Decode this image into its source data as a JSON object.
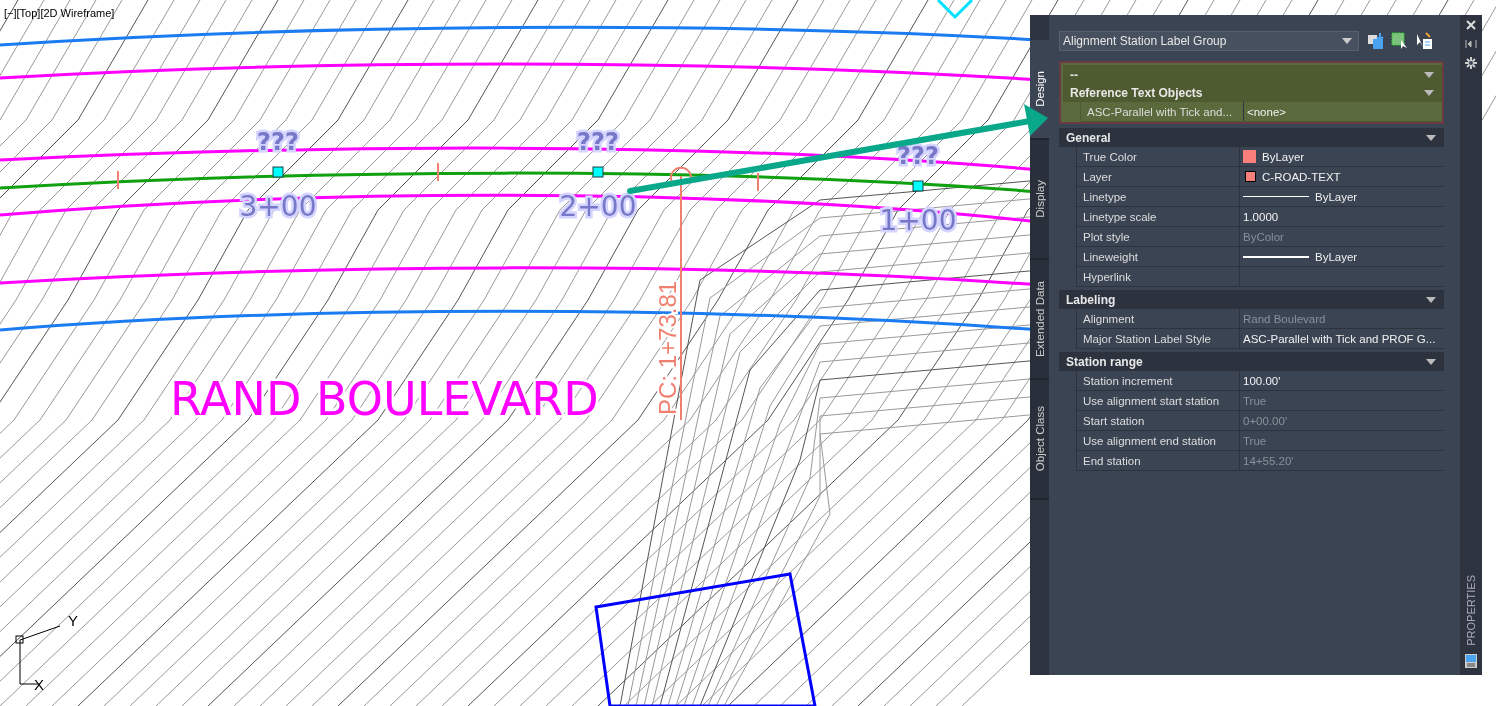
{
  "viewport": {
    "label": "[−][Top][2D Wireframe]"
  },
  "drawing": {
    "stations": [
      {
        "mark": "???",
        "station": "3+00"
      },
      {
        "mark": "???",
        "station": "2+00"
      },
      {
        "mark": "???",
        "station": "1+00"
      }
    ],
    "street_name": "RAND BOULEVARD",
    "curve_label": "PC: 1+73.81",
    "ucs": {
      "y": "Y",
      "x": "X"
    }
  },
  "properties": {
    "object_type": "Alignment Station Label Group",
    "tabs": [
      {
        "label": "Design",
        "selected": true
      },
      {
        "label": "Display",
        "selected": false
      },
      {
        "label": "Extended Data",
        "selected": false
      },
      {
        "label": "Object Class",
        "selected": false
      }
    ],
    "sections": [
      {
        "title": "--",
        "expanded": true,
        "highlighted": true
      },
      {
        "title": "Reference Text Objects",
        "expanded": true,
        "highlighted": true,
        "rows": [
          {
            "kind": "text",
            "name": "ASC-Parallel with Tick and...",
            "value": "<none>",
            "disabled": false
          }
        ]
      },
      {
        "title": "General",
        "expanded": true,
        "highlighted": false,
        "rows": [
          {
            "kind": "swatch",
            "name": "True Color",
            "value": "ByLayer",
            "color": "#f87f7a",
            "disabled": false
          },
          {
            "kind": "layer",
            "name": "Layer",
            "value": "C-ROAD-TEXT",
            "color": "#f87f7a",
            "disabled": false
          },
          {
            "kind": "line",
            "name": "Linetype",
            "value": "ByLayer",
            "disabled": false
          },
          {
            "kind": "text",
            "name": "Linetype scale",
            "value": "1.0000",
            "disabled": false
          },
          {
            "kind": "text",
            "name": "Plot style",
            "value": "ByColor",
            "disabled": true
          },
          {
            "kind": "line",
            "name": "Lineweight",
            "value": "ByLayer",
            "disabled": false
          },
          {
            "kind": "empty",
            "name": "Hyperlink"
          }
        ]
      },
      {
        "title": "Labeling",
        "expanded": true,
        "highlighted": false,
        "rows": [
          {
            "kind": "text",
            "name": "Alignment",
            "value": "Rand Boulevard",
            "disabled": true
          },
          {
            "kind": "text",
            "name": "Major Station Label Style",
            "value": "ASC-Parallel with Tick and PROF G...",
            "disabled": false
          }
        ]
      },
      {
        "title": "Station range",
        "expanded": true,
        "highlighted": false,
        "rows": [
          {
            "kind": "text",
            "name": "Station increment",
            "value": "100.00'",
            "disabled": false
          },
          {
            "kind": "text",
            "name": "Use alignment start station",
            "value": "True",
            "disabled": true
          },
          {
            "kind": "text",
            "name": "Start station",
            "value": "0+00.00'",
            "disabled": true
          },
          {
            "kind": "text",
            "name": "Use alignment end station",
            "value": "True",
            "disabled": true
          },
          {
            "kind": "text",
            "name": "End station",
            "value": "14+55.20'",
            "disabled": true
          }
        ]
      }
    ],
    "palette_title": "PROPERTIES"
  }
}
